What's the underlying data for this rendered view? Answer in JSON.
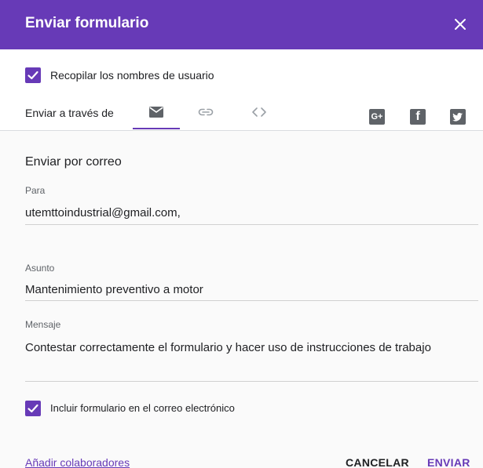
{
  "dialog": {
    "title": "Enviar formulario",
    "close_icon": "close-icon",
    "accent_color": "#673ab7"
  },
  "collect_usernames": {
    "checked": true,
    "label": "Recopilar los nombres de usuario"
  },
  "send_via": {
    "label": "Enviar a través de",
    "tabs": [
      {
        "icon": "email-icon",
        "selected": true
      },
      {
        "icon": "link-icon",
        "selected": false
      },
      {
        "icon": "embed-code-icon",
        "selected": false
      }
    ],
    "social": [
      {
        "icon": "google-plus-icon",
        "text": "G+"
      },
      {
        "icon": "facebook-icon",
        "text": "f"
      },
      {
        "icon": "twitter-icon",
        "text": ""
      }
    ]
  },
  "email": {
    "section_title": "Enviar por correo",
    "to_label": "Para",
    "to_value": "utemttoindustrial@gmail.com,",
    "subject_label": "Asunto",
    "subject_value": "Mantenimiento preventivo a motor",
    "message_label": "Mensaje",
    "message_value": "Contestar correctamente el formulario y hacer uso de instrucciones de trabajo",
    "include_form": {
      "checked": true,
      "label": "Incluir formulario en el correo electrónico"
    }
  },
  "footer": {
    "add_collaborators": "Añadir colaboradores",
    "cancel": "CANCELAR",
    "send": "ENVIAR"
  }
}
